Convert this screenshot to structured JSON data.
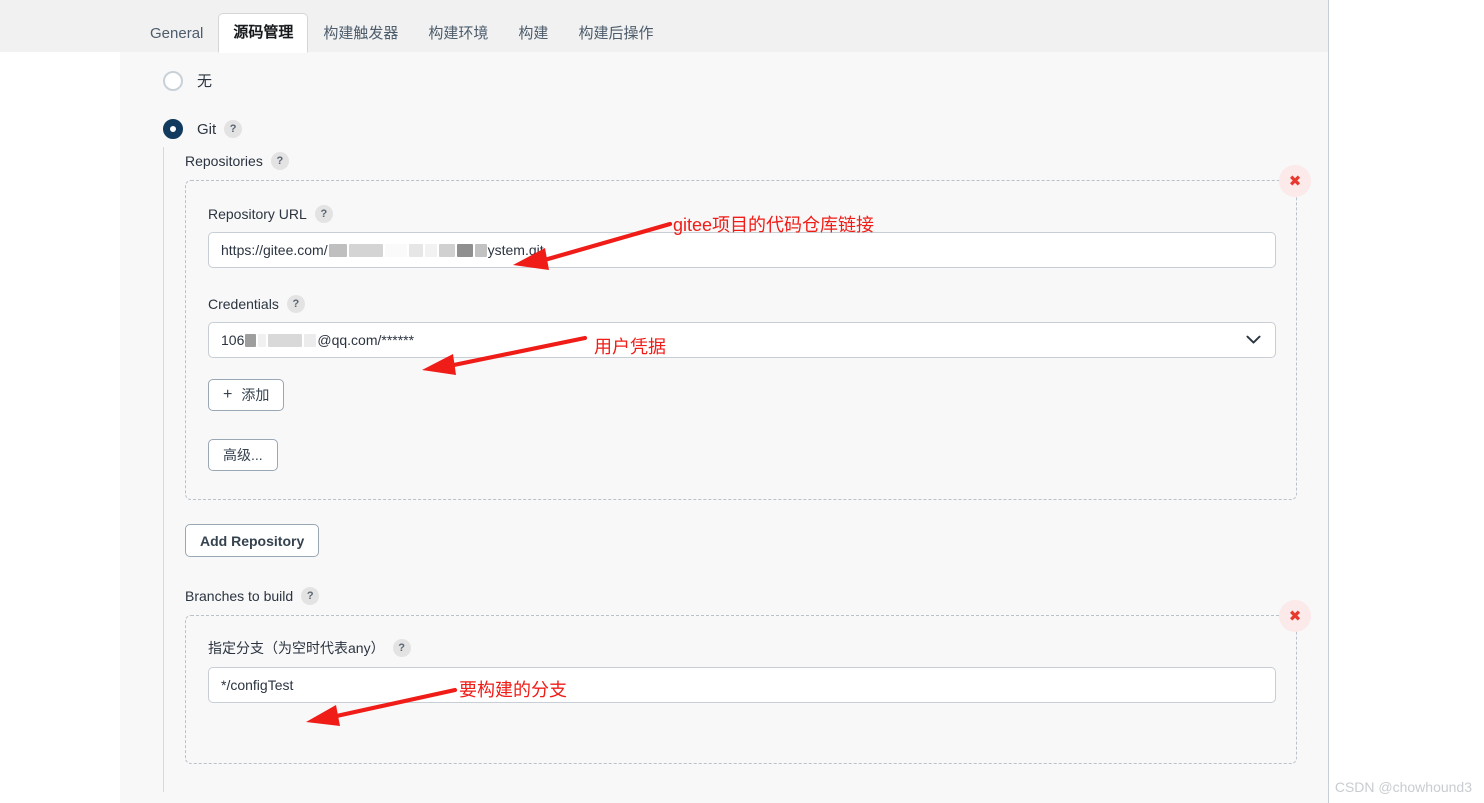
{
  "tabs": [
    {
      "label": "General",
      "active": false
    },
    {
      "label": "源码管理",
      "active": true
    },
    {
      "label": "构建触发器",
      "active": false
    },
    {
      "label": "构建环境",
      "active": false
    },
    {
      "label": "构建",
      "active": false
    },
    {
      "label": "构建后操作",
      "active": false
    }
  ],
  "scm": {
    "none_option": "无",
    "git_option": "Git",
    "help_glyph": "?",
    "repositories_label": "Repositories",
    "repository": {
      "url_label": "Repository URL",
      "url_prefix": "https://gitee.com/",
      "url_suffix": "ystem.git",
      "credentials_label": "Credentials",
      "credentials_prefix": "106",
      "credentials_suffix": "@qq.com/******",
      "add_button": "添加",
      "add_button_plus": "+",
      "advanced_button": "高级...",
      "delete_glyph": "✖"
    },
    "add_repository_button": "Add Repository",
    "branches_label": "Branches to build",
    "branch": {
      "label": "指定分支（为空时代表any）",
      "value": "*/configTest",
      "delete_glyph": "✖"
    },
    "chevron_glyph": "chevron-down-icon"
  },
  "annotations": {
    "repo_url": "gitee项目的代码仓库链接",
    "credentials": "用户凭据",
    "branch": "要构建的分支",
    "color": "#f01c17"
  },
  "watermark": "CSDN @chowhound3"
}
